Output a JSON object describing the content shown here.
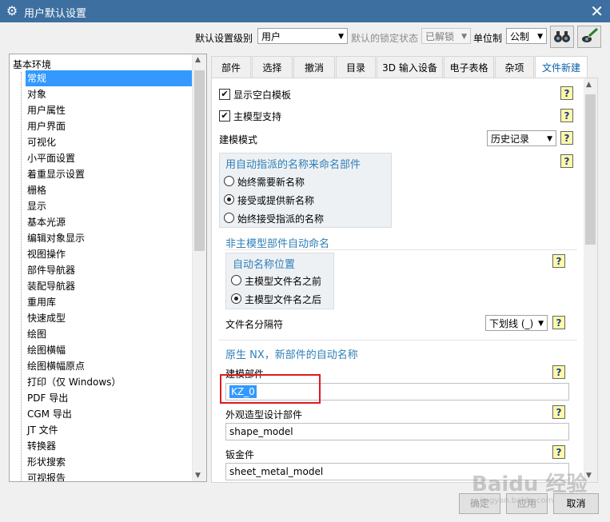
{
  "window": {
    "title": "用户默认设置",
    "close_glyph": "✕"
  },
  "toolbar": {
    "level_label": "默认设置级别",
    "level_value": "用户",
    "lock_label": "默认的锁定状态",
    "lock_value": "已解锁",
    "unit_label": "单位制",
    "unit_value": "公制"
  },
  "tree": {
    "root": "基本环境",
    "items": [
      "常规",
      "对象",
      "用户属性",
      "用户界面",
      "可视化",
      "小平面设置",
      "着重显示设置",
      "栅格",
      "显示",
      "基本光源",
      "编辑对象显示",
      "视图操作",
      "部件导航器",
      "装配导航器",
      "重用库",
      "快速成型",
      "绘图",
      "绘图横幅",
      "绘图横幅原点",
      "打印（仅 Windows）",
      "PDF 导出",
      "CGM 导出",
      "JT 文件",
      "转换器",
      "形状搜索",
      "可视报告"
    ],
    "selected_index": 0
  },
  "tabs": [
    "部件",
    "选择",
    "撤消",
    "目录",
    "3D 输入设备",
    "电子表格",
    "杂项",
    "文件新建"
  ],
  "active_tab": 7,
  "panel": {
    "show_blank_template": "显示空白模板",
    "master_model_support": "主模型支持",
    "modeling_mode_label": "建模模式",
    "modeling_mode_value": "历史记录",
    "auto_name_group": "用自动指派的名称来命名部件",
    "radio_always_new": "始终需要新名称",
    "radio_accept_new": "接受或提供新名称",
    "radio_always_accept": "始终接受指派的名称",
    "non_master_section": "非主模型部件自动命名",
    "auto_pos_group": "自动名称位置",
    "radio_before": "主模型文件名之前",
    "radio_after": "主模型文件名之后",
    "separator_label": "文件名分隔符",
    "separator_value": "下划线 (_)",
    "native_section": "原生 NX，新部件的自动名称",
    "modeling_part_label": "建模部件",
    "modeling_part_value": "KZ_0",
    "shape_label": "外观造型设计部件",
    "shape_value": "shape_model",
    "sheet_label": "钣金件",
    "sheet_value": "sheet_metal_model",
    "help_glyph": "?"
  },
  "buttons": {
    "ok": "确定",
    "apply": "应用",
    "cancel": "取消"
  },
  "watermark": {
    "main": "Baidu 经验",
    "sub": "jingyan.baidu.com"
  }
}
